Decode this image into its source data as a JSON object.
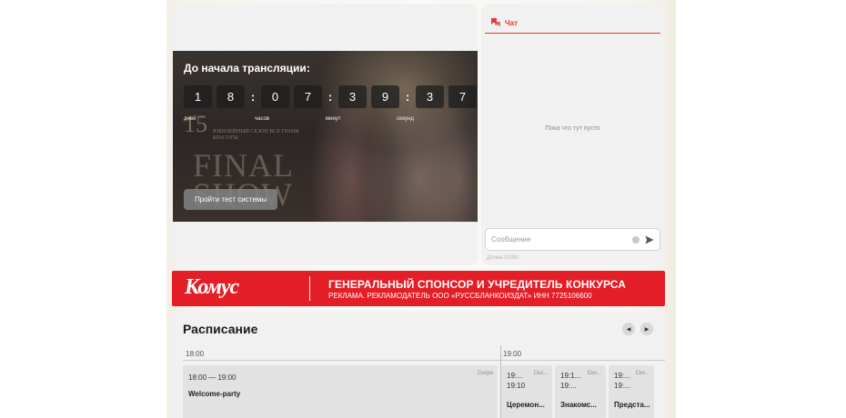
{
  "player": {
    "countdown_title": "До начала трансляции:",
    "digits": [
      "1",
      "8",
      ":",
      "0",
      "7",
      ":",
      "3",
      "9",
      ":",
      "3",
      "7"
    ],
    "units": [
      "дней",
      "часов",
      "минут",
      "секунд"
    ],
    "test_button": "Пройти тест системы",
    "overlay": {
      "number": "15",
      "small_text": "ЮБИЛЕЙНЫЙ СЕЗОН ВСЕ ГРАНИ КРАСОТЫ",
      "big_line1": "FINAL",
      "big_line2": "SHOW"
    }
  },
  "chat": {
    "tab_label": "Чат",
    "empty_text": "Пока что тут пусто",
    "input_placeholder": "Сообщение",
    "counter": "Длина 0/250"
  },
  "banner": {
    "logo": "Комус",
    "title": "ГЕНЕРАЛЬНЫЙ СПОНСОР И УЧРЕДИТЕЛЬ КОНКУРСА",
    "subtitle": "РЕКЛАМА. РЕКЛАМОДАТЕЛЬ ООО «РУССБЛАНКОИЗДАТ» ИНН 7725106600"
  },
  "schedule": {
    "title": "Расписание",
    "prev_icon": "◀",
    "next_icon": "▶",
    "times": [
      "18:00",
      "19:00"
    ],
    "events": [
      {
        "time": "18:00 — 19:00",
        "status": "Скоро",
        "name": "Welcome-party"
      },
      {
        "time": "19:...\n19:10",
        "status": "Ско...",
        "name": "Церемон..."
      },
      {
        "time": "19:1...\n19:...",
        "status": "Ско...",
        "name": "Знакомс..."
      },
      {
        "time": "19:...\n19:...",
        "status": "Ско...",
        "name": "Предста..."
      }
    ]
  },
  "colors": {
    "accent": "#e43b3b",
    "banner": "#e41e26",
    "card": "#f1f1f1"
  }
}
